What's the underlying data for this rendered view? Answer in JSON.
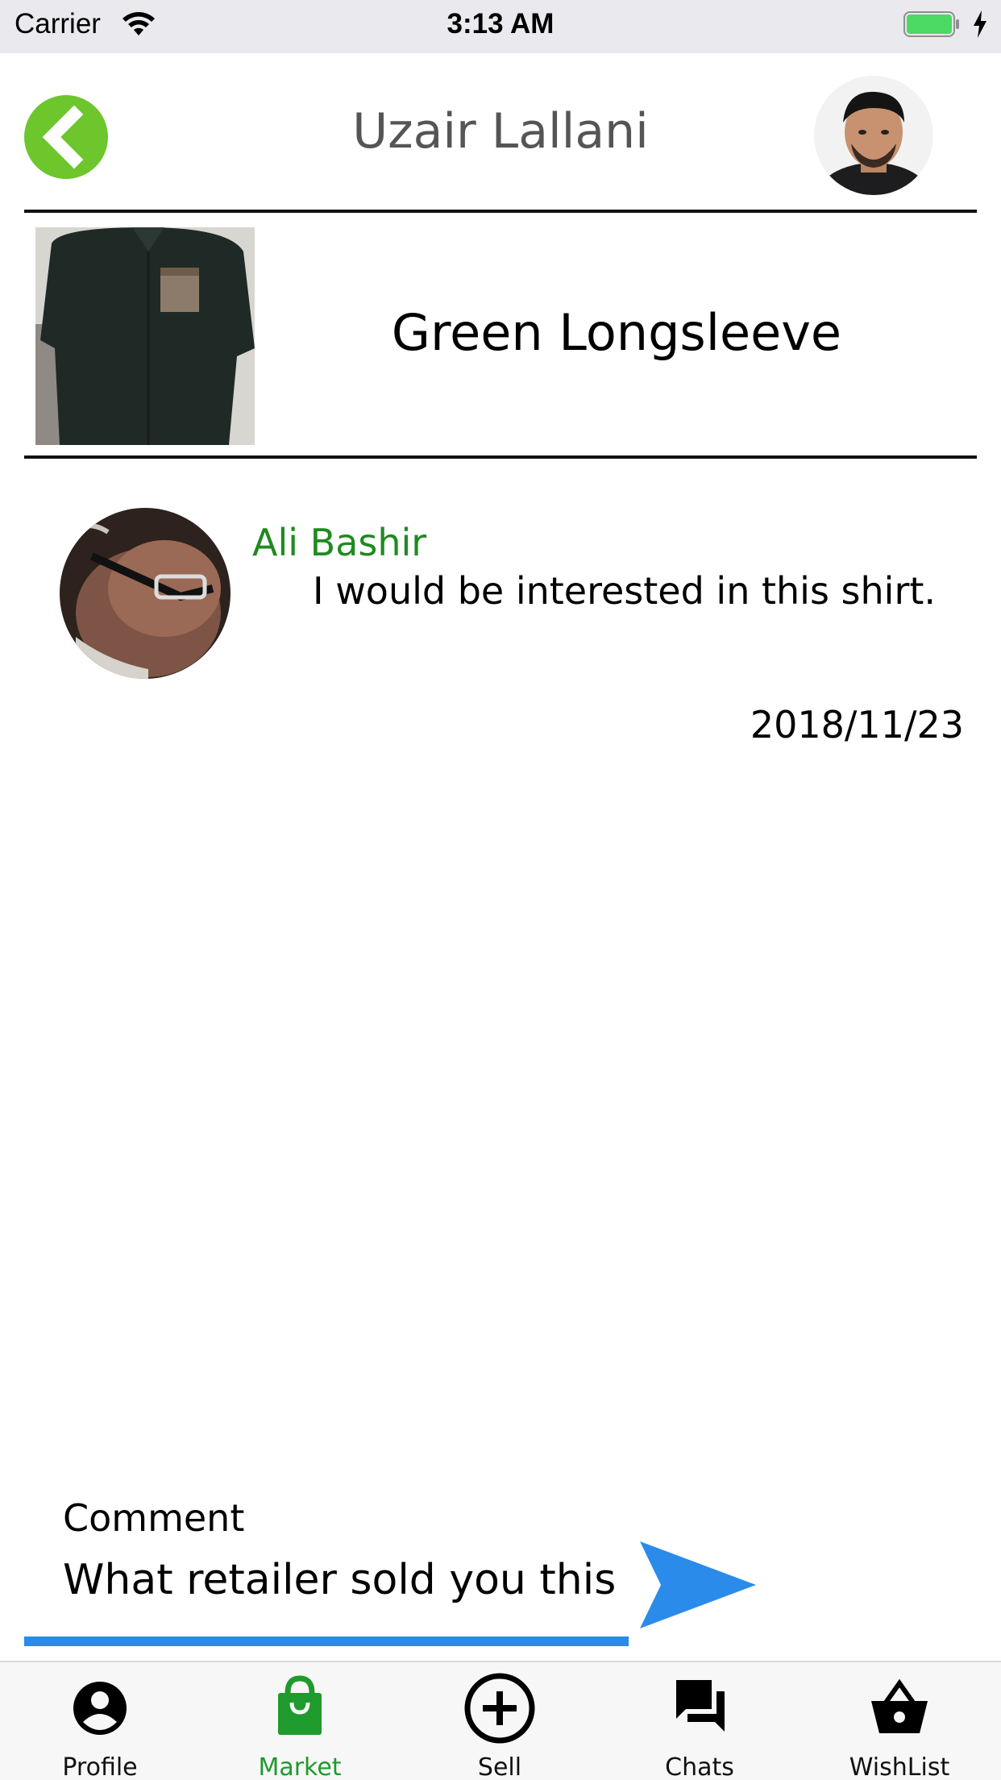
{
  "status_bar": {
    "carrier": "Carrier",
    "time": "3:13 AM"
  },
  "header": {
    "title": "Uzair Lallani"
  },
  "product": {
    "title": "Green Longsleeve"
  },
  "messages": [
    {
      "sender": "Ali Bashir",
      "text": "I would be interested in this shirt.",
      "date": "2018/11/23"
    }
  ],
  "comment": {
    "label": "Comment",
    "value": "What retailer sold you this?"
  },
  "tabs": [
    {
      "label": "Profile",
      "icon": "person-icon",
      "active": false
    },
    {
      "label": "Market",
      "icon": "shopping-bag-icon",
      "active": true
    },
    {
      "label": "Sell",
      "icon": "plus-circle-icon",
      "active": false
    },
    {
      "label": "Chats",
      "icon": "chat-bubbles-icon",
      "active": false
    },
    {
      "label": "WishList",
      "icon": "basket-icon",
      "active": false
    }
  ],
  "colors": {
    "accent_green": "#1f9a2c",
    "sender_green": "#1f8a1f",
    "back_button_green": "#6cc62c",
    "send_blue": "#2a8bea",
    "battery_green": "#4cd964"
  }
}
